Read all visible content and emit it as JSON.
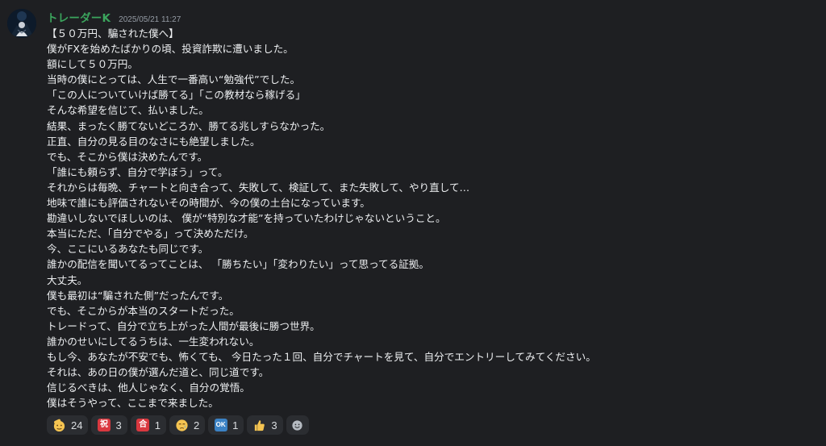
{
  "message": {
    "author": "トレーダーK",
    "timestamp": "2025/05/21 11:27",
    "author_color": "#3ba55d",
    "lines": [
      "【５０万円、騙された僕へ】",
      "僕がFXを始めたばかりの頃、投資詐欺に遭いました。",
      "額にして５０万円。",
      "当時の僕にとっては、人生で一番高い“勉強代”でした。",
      "「この人についていけば勝てる」「この教材なら稼げる」",
      "そんな希望を信じて、払いました。",
      "結果、まったく勝てないどころか、勝てる兆しすらなかった。",
      "正直、自分の見る目のなさにも絶望しました。",
      "でも、そこから僕は決めたんです。",
      "「誰にも頼らず、自分で学ぼう」って。",
      "それからは毎晩、チャートと向き合って、失敗して、検証して、また失敗して、やり直して…",
      "地味で誰にも評価されないその時間が、今の僕の土台になっています。",
      "勘違いしないでほしいのは、 僕が“特別な才能”を持っていたわけじゃないということ。",
      "本当にただ、「自分でやる」って決めただけ。",
      "今、ここにいるあなたも同じです。",
      "誰かの配信を聞いてるってことは、 「勝ちたい」「変わりたい」って思ってる証拠。",
      "大丈夫。",
      "僕も最初は“騙された側”だったんです。",
      "でも、そこからが本当のスタートだった。",
      "トレードって、自分で立ち上がった人間が最後に勝つ世界。",
      "誰かのせいにしてるうちは、一生変われない。",
      "もし今、あなたが不安でも、怖くても、 今日たった１回、自分でチャートを見て、自分でエントリーしてみてください。",
      "それは、あの日の僕が選んだ道と、同じ道です。",
      "信じるべきは、他人じゃなく、自分の覚悟。",
      "僕はそうやって、ここまで来ました。"
    ]
  },
  "reactions": [
    {
      "icon": "saluting-face-icon",
      "count": "24"
    },
    {
      "icon": "congratulations-icon",
      "glyph": "祝",
      "count": "3"
    },
    {
      "icon": "passing-grade-icon",
      "glyph": "合",
      "count": "1"
    },
    {
      "icon": "crying-face-icon",
      "count": "2"
    },
    {
      "icon": "ok-button-icon",
      "glyph": "OK",
      "count": "1"
    },
    {
      "icon": "thumbs-up-icon",
      "count": "3"
    }
  ],
  "add_reaction_icon": "add-reaction-icon",
  "colors": {
    "background": "#1e1f22",
    "text": "#eef0f2",
    "timestamp": "#949ba4",
    "reaction_bg": "#2b2d31"
  }
}
